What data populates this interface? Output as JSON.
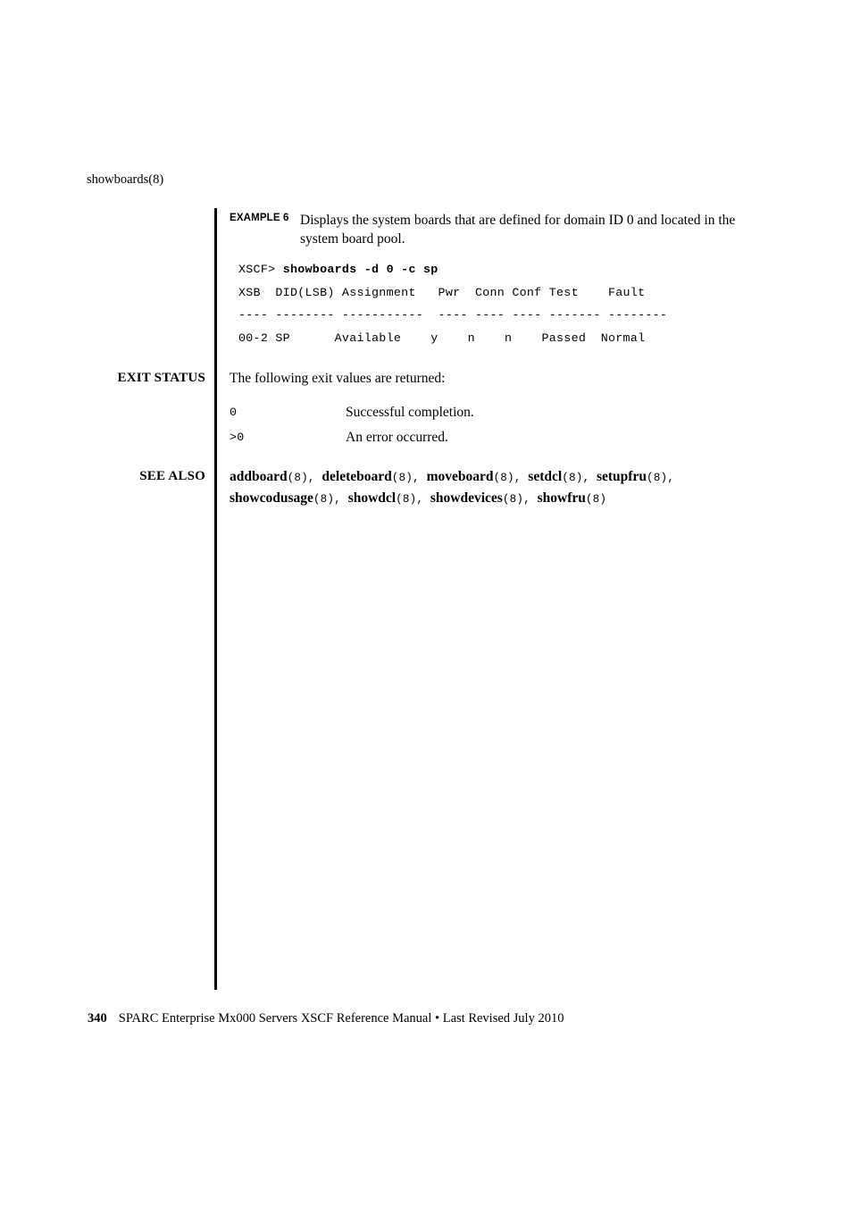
{
  "running_head": "showboards(8)",
  "example": {
    "tag": "EXAMPLE 6",
    "description": "Displays the system boards that are defined for domain ID 0 and located in the system board pool.",
    "terminal": {
      "prompt": "XSCF> ",
      "command": "showboards -d 0 -c sp",
      "header": "XSB  DID(LSB) Assignment   Pwr  Conn Conf Test    Fault",
      "separator": "---- -------- -----------  ---- ---- ---- ------- --------",
      "row": "00-2 SP      Available    y    n    n    Passed  Normal"
    }
  },
  "exit_status": {
    "label": "EXIT STATUS",
    "intro": "The following exit values are returned:",
    "rows": [
      {
        "code": "0",
        "description": "Successful completion."
      },
      {
        "code": ">0",
        "description": "An error occurred."
      }
    ]
  },
  "see_also": {
    "label": "SEE ALSO",
    "entries": [
      {
        "name": "addboard",
        "section": "(8)",
        "trailing": ", "
      },
      {
        "name": "deleteboard",
        "section": "(8)",
        "trailing": ", "
      },
      {
        "name": "moveboard",
        "section": "(8)",
        "trailing": ", "
      },
      {
        "name": "setdcl",
        "section": "(8)",
        "trailing": ", "
      },
      {
        "name": "setupfru",
        "section": "(8)",
        "trailing": ", "
      },
      {
        "name": "showcodusage",
        "section": "(8)",
        "trailing": ", "
      },
      {
        "name": "showdcl",
        "section": "(8)",
        "trailing": ", "
      },
      {
        "name": "showdevices",
        "section": "(8)",
        "trailing": ", "
      },
      {
        "name": "showfru",
        "section": "(8)",
        "trailing": ""
      }
    ]
  },
  "footer": {
    "page_number": "340",
    "text": "SPARC Enterprise Mx000 Servers XSCF Reference Manual • Last Revised July 2010"
  }
}
